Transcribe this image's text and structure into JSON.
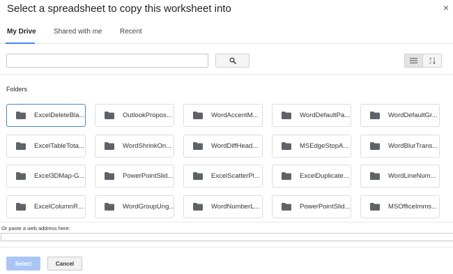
{
  "dialog": {
    "title": "Select a spreadsheet to copy this worksheet into",
    "close_glyph": "×"
  },
  "tabs": [
    {
      "label": "My Drive",
      "active": true
    },
    {
      "label": "Shared with me",
      "active": false
    },
    {
      "label": "Recent",
      "active": false
    }
  ],
  "search": {
    "value": "",
    "button_icon": "search-icon"
  },
  "view_toggle": {
    "list_icon": "list-view-icon",
    "sort_icon": "sort-az-icon"
  },
  "folders_label": "Folders",
  "folders": [
    {
      "name": "ExcelDeleteBla...",
      "selected": true
    },
    {
      "name": "OutlookPropos...",
      "selected": false
    },
    {
      "name": "WordAccentM...",
      "selected": false
    },
    {
      "name": "WordDefaultPa...",
      "selected": false
    },
    {
      "name": "WordDefaultGr...",
      "selected": false
    },
    {
      "name": "ExcelTableTota...",
      "selected": false
    },
    {
      "name": "WordShrinkOn...",
      "selected": false
    },
    {
      "name": "WordDiffHead...",
      "selected": false
    },
    {
      "name": "MSEdgeStopA...",
      "selected": false
    },
    {
      "name": "WordBlurTrans...",
      "selected": false
    },
    {
      "name": "Excel3DMap-G...",
      "selected": false
    },
    {
      "name": "PowerPointSlid...",
      "selected": false
    },
    {
      "name": "ExcelScatterPl...",
      "selected": false
    },
    {
      "name": "ExcelDuplicate...",
      "selected": false
    },
    {
      "name": "WordLineNum...",
      "selected": false
    },
    {
      "name": "ExcelColumnR...",
      "selected": false
    },
    {
      "name": "WordGroupUng...",
      "selected": false
    },
    {
      "name": "WordNumberL...",
      "selected": false
    },
    {
      "name": "PowerPointSlid...",
      "selected": false
    },
    {
      "name": "MSOfficeImms...",
      "selected": false
    }
  ],
  "url": {
    "label": "Or paste a web address here:",
    "value": ""
  },
  "buttons": {
    "select": "Select",
    "cancel": "Cancel"
  },
  "colors": {
    "accent": "#4285f4",
    "selected_border": "#4a88c8",
    "select_button_bg": "#a9c6f5",
    "folder_icon": "#5f6368"
  }
}
